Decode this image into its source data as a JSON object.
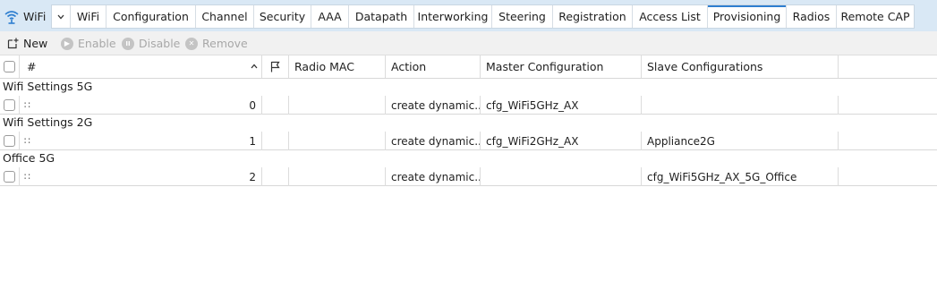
{
  "app": {
    "title": "WiFi",
    "icon": "wifi-icon"
  },
  "tabs": [
    {
      "label": "WiFi"
    },
    {
      "label": "Configuration"
    },
    {
      "label": "Channel"
    },
    {
      "label": "Security"
    },
    {
      "label": "AAA"
    },
    {
      "label": "Datapath"
    },
    {
      "label": "Interworking"
    },
    {
      "label": "Steering"
    },
    {
      "label": "Registration"
    },
    {
      "label": "Access List"
    },
    {
      "label": "Provisioning",
      "active": true
    },
    {
      "label": "Radios"
    },
    {
      "label": "Remote CAP"
    }
  ],
  "toolbar": {
    "new_label": "New",
    "enable_label": "Enable",
    "disable_label": "Disable",
    "remove_label": "Remove"
  },
  "table": {
    "columns": {
      "index": "#",
      "radio_mac": "Radio MAC",
      "action": "Action",
      "master": "Master Configuration",
      "slave": "Slave Configurations"
    },
    "groups": [
      {
        "title": "Wifi Settings 5G",
        "index": "0",
        "radio_mac": "",
        "action": "create dynamic...",
        "master": "cfg_WiFi5GHz_AX",
        "slave": ""
      },
      {
        "title": "Wifi Settings 2G",
        "index": "1",
        "radio_mac": "",
        "action": "create dynamic...",
        "master": "cfg_WiFi2GHz_AX",
        "slave": "Appliance2G"
      },
      {
        "title": "Office 5G",
        "index": "2",
        "radio_mac": "",
        "action": "create dynamic...",
        "master": "",
        "slave": "cfg_WiFi5GHz_AX_5G_Office"
      }
    ]
  },
  "colors": {
    "tab_strip": "#d9e8f5",
    "active_accent": "#2f7fd0",
    "toolbar_bg": "#f1f1f1"
  }
}
